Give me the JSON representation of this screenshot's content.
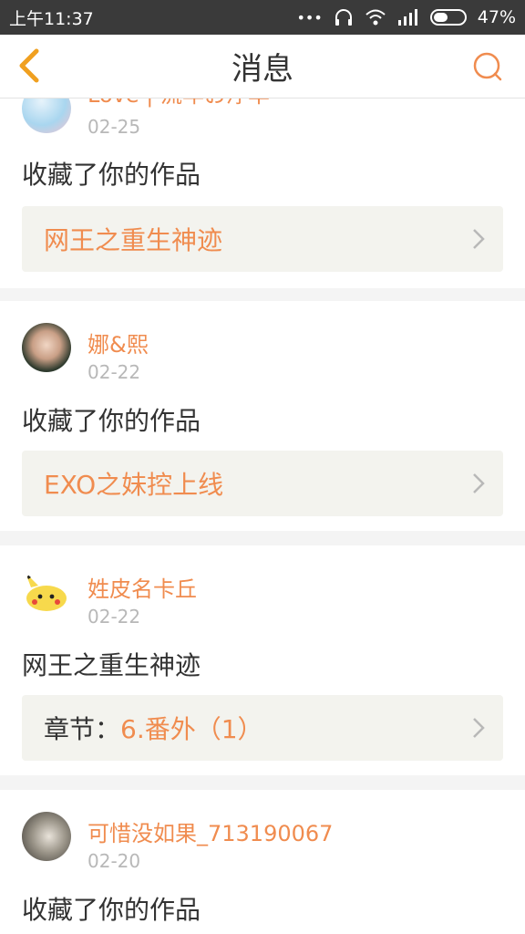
{
  "status_bar": {
    "time": "上午11:37",
    "battery": "47%",
    "battery_level": 0.47,
    "icons": [
      "more-dots-icon",
      "headphones-icon",
      "wifi-icon",
      "signal-icon",
      "battery-icon"
    ]
  },
  "header": {
    "title": "消息",
    "back_icon": "chevron-left-icon",
    "search_icon": "search-icon"
  },
  "colors": {
    "accent": "#f08c4f",
    "text": "#333333",
    "muted": "#b8b8b8",
    "box": "#f3f3ee"
  },
  "messages": [
    {
      "user": "Love | 流年お浮华",
      "date": "02-25",
      "action": "收藏了你的作品",
      "link_prefix": "",
      "link": "网王之重生神迹"
    },
    {
      "user": "娜&熙",
      "date": "02-22",
      "action": "收藏了你的作品",
      "link_prefix": "",
      "link": "EXO之妹控上线"
    },
    {
      "user": "姓皮名卡丘",
      "date": "02-22",
      "action": "网王之重生神迹",
      "link_prefix": "章节：",
      "link": "6.番外（1）"
    },
    {
      "user": "可惜没如果_713190067",
      "date": "02-20",
      "action": "收藏了你的作品",
      "link_prefix": "",
      "link": ""
    }
  ]
}
